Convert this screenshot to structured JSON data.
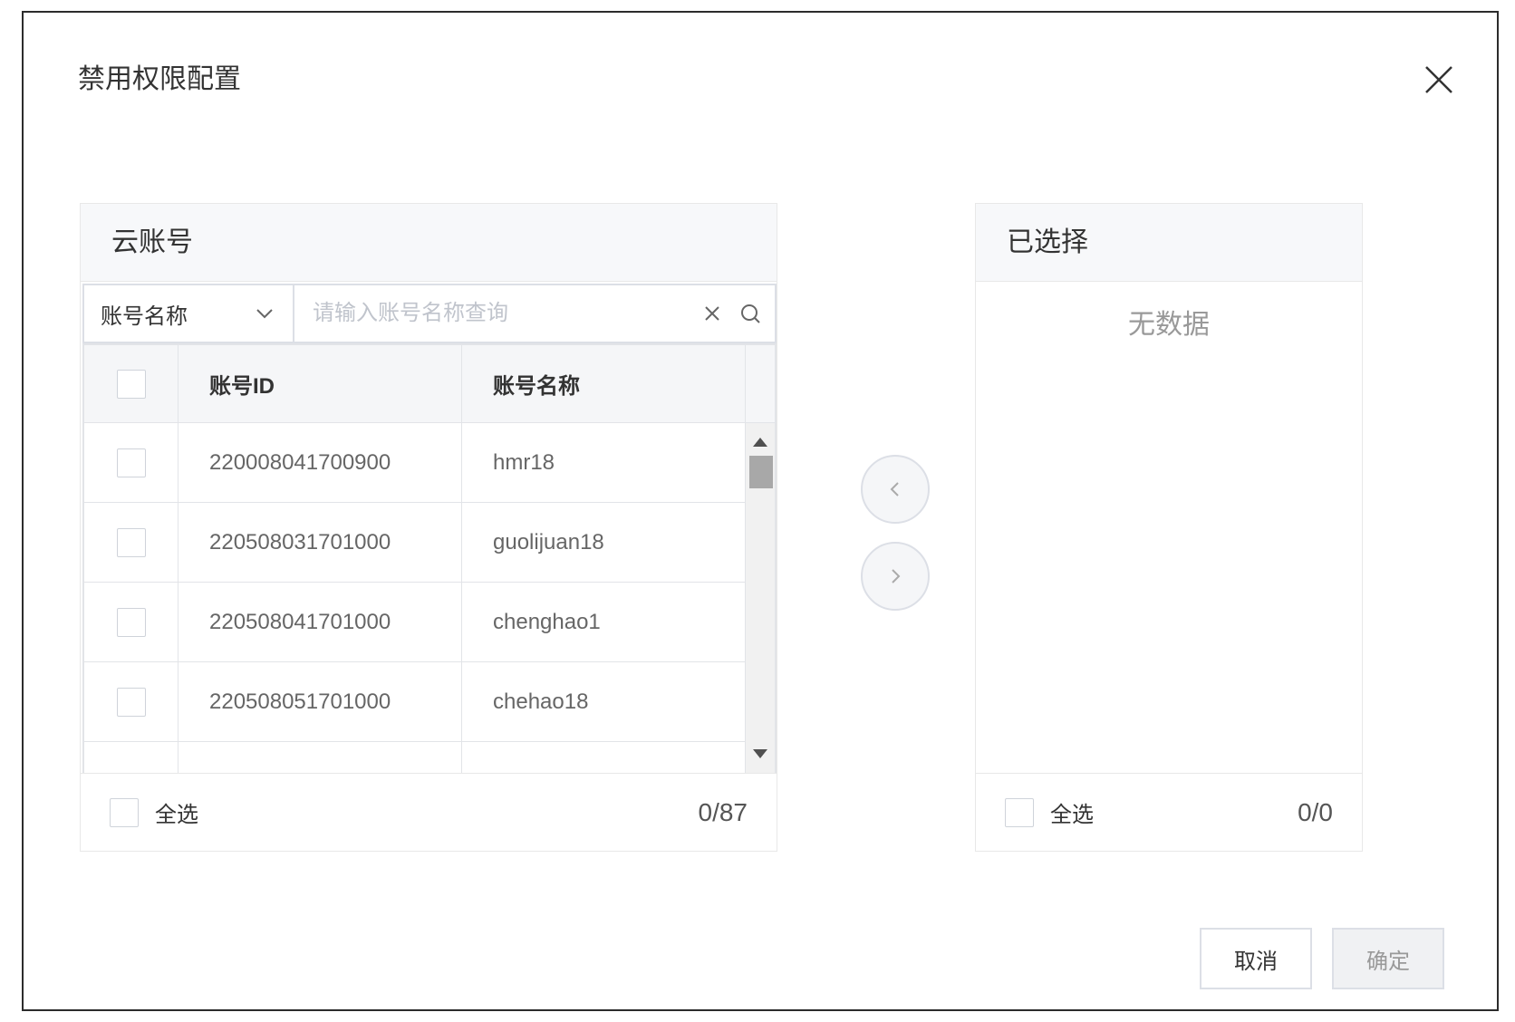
{
  "dialog": {
    "title": "禁用权限配置",
    "close_icon": "close-icon"
  },
  "source": {
    "header": "云账号",
    "filter": {
      "selected": "账号名称",
      "placeholder": "请输入账号名称查询",
      "value": ""
    },
    "columns": [
      "账号ID",
      "账号名称"
    ],
    "rows": [
      {
        "id": "220008041700900",
        "name": "hmr18"
      },
      {
        "id": "220508031701000",
        "name": "guolijuan18"
      },
      {
        "id": "220508041701000",
        "name": "chenghao1"
      },
      {
        "id": "220508051701000",
        "name": "chehao18"
      },
      {
        "id": "",
        "name": ""
      }
    ],
    "select_all": "全选",
    "count": "0/87"
  },
  "target": {
    "header": "已选择",
    "empty": "无数据",
    "select_all": "全选",
    "count": "0/0"
  },
  "buttons": {
    "cancel": "取消",
    "ok": "确定"
  },
  "colors": {
    "border": "#dcdfe6",
    "header_bg": "#f7f8fa",
    "muted_text": "#999999"
  }
}
